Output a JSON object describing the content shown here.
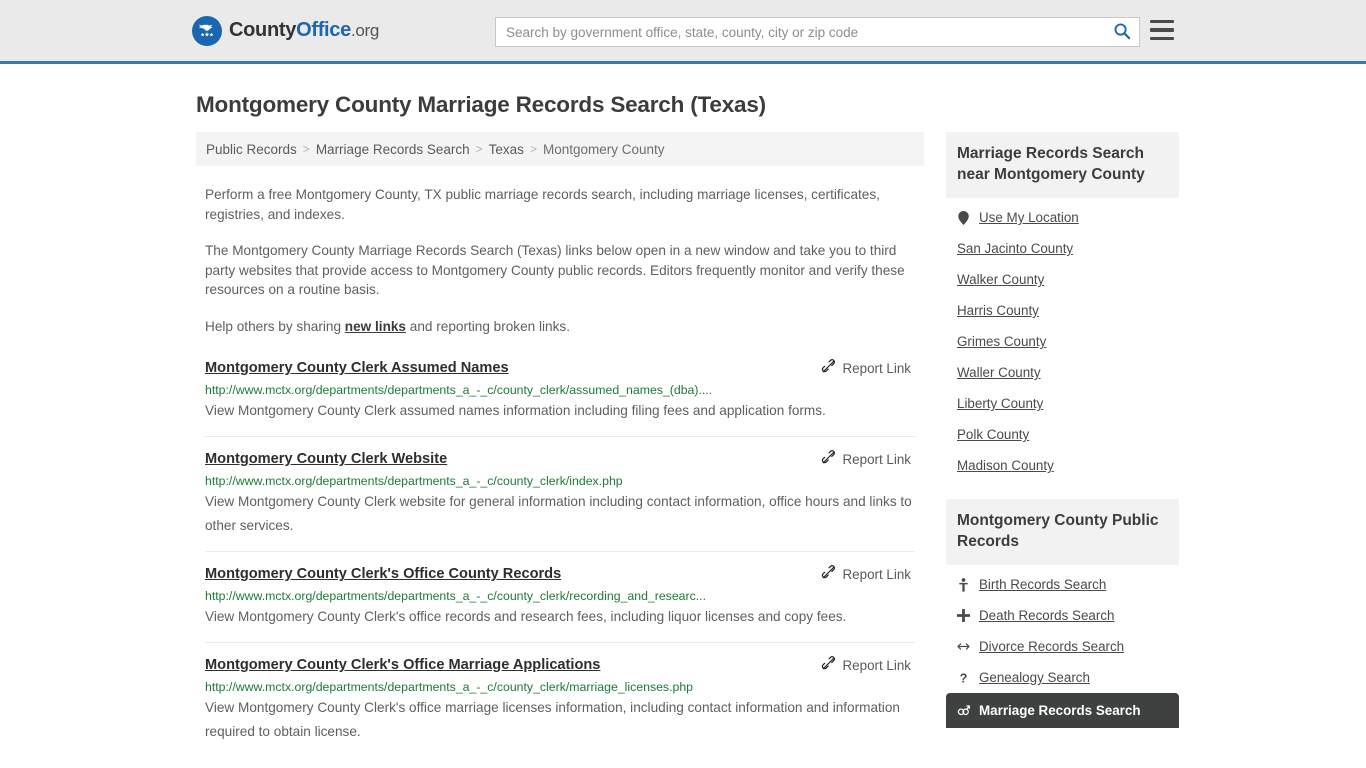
{
  "header": {
    "logo": {
      "icon": "eagle-seal-icon",
      "text_county": "County",
      "text_office": "Office",
      "text_tld": ".org"
    },
    "search": {
      "placeholder": "Search by government office, state, county, city or zip code",
      "value": "",
      "icon": "search-icon"
    },
    "menu_icon": "hamburger-menu-icon"
  },
  "page": {
    "title": "Montgomery County Marriage Records Search (Texas)"
  },
  "breadcrumb": {
    "separator": ">",
    "items": [
      {
        "label": "Public Records",
        "current": false
      },
      {
        "label": "Marriage Records Search",
        "current": false
      },
      {
        "label": "Texas",
        "current": false
      },
      {
        "label": "Montgomery County",
        "current": true
      }
    ]
  },
  "intro": {
    "p1": "Perform a free Montgomery County, TX public marriage records search, including marriage licenses, certificates, registries, and indexes.",
    "p2": "The Montgomery County Marriage Records Search (Texas) links below open in a new window and take you to third party websites that provide access to Montgomery County public records. Editors frequently monitor and verify these resources on a routine basis.",
    "p3_before": "Help others by sharing ",
    "p3_link": "new links",
    "p3_after": " and reporting broken links."
  },
  "results": {
    "report_label": "Report Link",
    "report_icon": "broken-link-icon",
    "items": [
      {
        "title": "Montgomery County Clerk Assumed Names",
        "url": "http://www.mctx.org/departments/departments_a_-_c/county_clerk/assumed_names_(dba)....",
        "description": "View Montgomery County Clerk assumed names information including filing fees and application forms."
      },
      {
        "title": "Montgomery County Clerk Website",
        "url": "http://www.mctx.org/departments/departments_a_-_c/county_clerk/index.php",
        "description": "View Montgomery County Clerk website for general information including contact information, office hours and links to other services."
      },
      {
        "title": "Montgomery County Clerk's Office County Records",
        "url": "http://www.mctx.org/departments/departments_a_-_c/county_clerk/recording_and_researc...",
        "description": "View Montgomery County Clerk's office records and research fees, including liquor licenses and copy fees."
      },
      {
        "title": "Montgomery County Clerk's Office Marriage Applications",
        "url": "http://www.mctx.org/departments/departments_a_-_c/county_clerk/marriage_licenses.php",
        "description": "View Montgomery County Clerk's office marriage licenses information, including contact information and information required to obtain license."
      }
    ]
  },
  "sidebar": {
    "nearby": {
      "heading": "Marriage Records Search near Montgomery County",
      "items": [
        {
          "label": "Use My Location",
          "icon": "map-pin-icon",
          "active": false
        },
        {
          "label": "San Jacinto County",
          "icon": "",
          "active": false
        },
        {
          "label": "Walker County",
          "icon": "",
          "active": false
        },
        {
          "label": "Harris County",
          "icon": "",
          "active": false
        },
        {
          "label": "Grimes County",
          "icon": "",
          "active": false
        },
        {
          "label": "Waller County",
          "icon": "",
          "active": false
        },
        {
          "label": "Liberty County",
          "icon": "",
          "active": false
        },
        {
          "label": "Polk County",
          "icon": "",
          "active": false
        },
        {
          "label": "Madison County",
          "icon": "",
          "active": false
        }
      ]
    },
    "public_records": {
      "heading": "Montgomery County Public Records",
      "items": [
        {
          "label": "Birth Records Search",
          "icon": "baby-icon",
          "active": false
        },
        {
          "label": "Death Records Search",
          "icon": "cross-icon",
          "active": false
        },
        {
          "label": "Divorce Records Search",
          "icon": "split-arrows-icon",
          "active": false
        },
        {
          "label": "Genealogy Search",
          "icon": "question-mark-icon",
          "active": false
        },
        {
          "label": "Marriage Records Search",
          "icon": "gender-symbols-icon",
          "active": true
        }
      ]
    }
  },
  "colors": {
    "header_bg": "#ebeaea",
    "header_border": "#3b78ad",
    "brand_blue": "#1a66b0",
    "url_green": "#1d7a36",
    "active_bg": "#3f4040",
    "panel_bg": "#f2f2f2"
  }
}
